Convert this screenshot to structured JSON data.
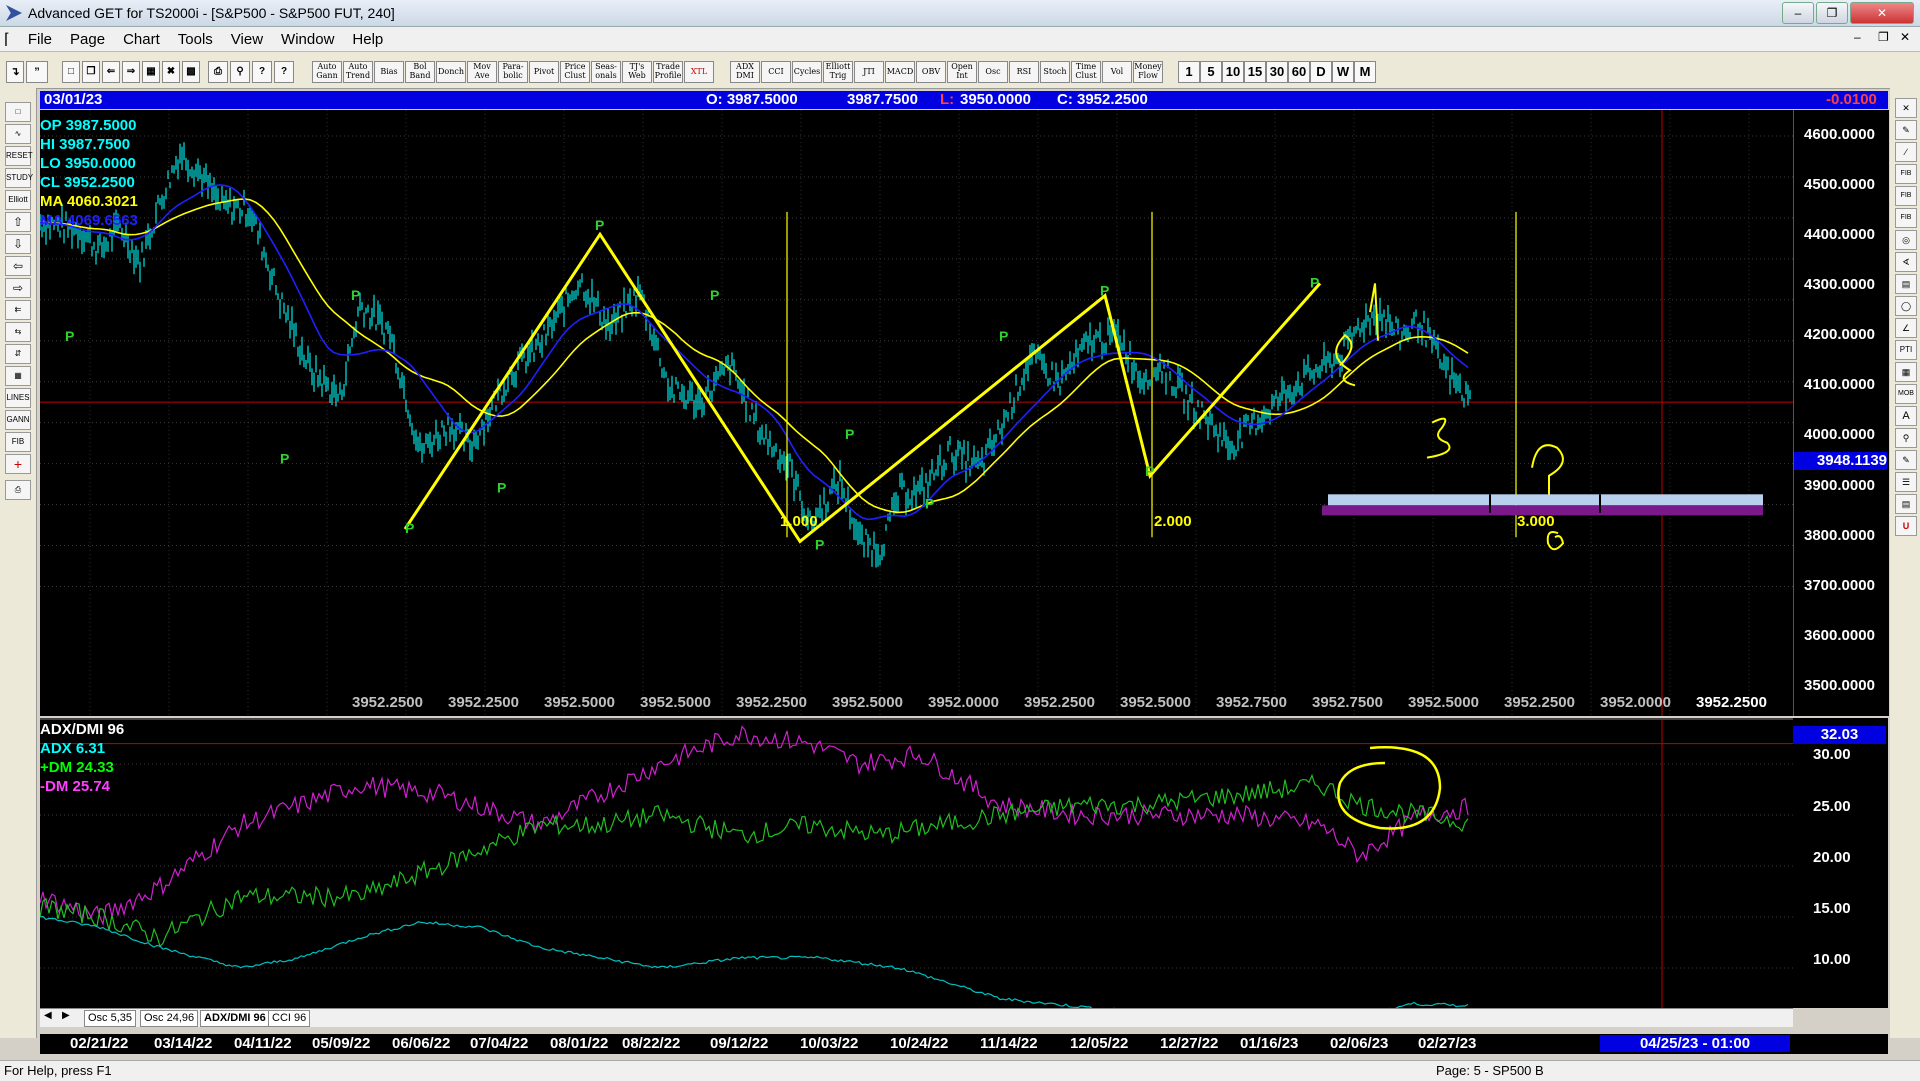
{
  "window": {
    "title": "Advanced GET for TS2000i - [S&P500 - S&P500 FUT, 240]"
  },
  "menu": [
    "File",
    "Page",
    "Chart",
    "Tools",
    "View",
    "Window",
    "Help"
  ],
  "toolbar": {
    "studies": [
      "Auto Gann",
      "Auto Trend",
      "Bias",
      "Bol Band",
      "Donch",
      "Mov Ave",
      "Para-bolic",
      "Pivot",
      "Price Clust",
      "Seas-onals",
      "TJ's Web",
      "Trade Profile",
      "XTL",
      "ADX DMI",
      "CCI",
      "Cycles",
      "Elliott Trig",
      "JTI",
      "MACD",
      "OBV",
      "Open Int",
      "Osc",
      "RSI",
      "Stoch",
      "Time Clust",
      "Vol",
      "Money Flow"
    ],
    "intervals": [
      "1",
      "5",
      "10",
      "15",
      "30",
      "60",
      "D",
      "W",
      "M"
    ]
  },
  "infobar": {
    "date": "03/01/23",
    "open": "O: 3987.5000",
    "high": "3987.7500",
    "low_label": "L:",
    "low": "3950.0000",
    "close": "C: 3952.2500",
    "change": "-0.0100"
  },
  "legend": [
    {
      "text": "OP  3987.5000",
      "color": "#00ffff"
    },
    {
      "text": "HI   3987.7500",
      "color": "#00ffff"
    },
    {
      "text": "LO  3950.0000",
      "color": "#00ffff"
    },
    {
      "text": "CL  3952.2500",
      "color": "#00ffff"
    },
    {
      "text": "MA  4060.3021",
      "color": "#ffff00"
    },
    {
      "text": "MA  4069.6563",
      "color": "#2020ff"
    }
  ],
  "price_axis": [
    "4600.0000",
    "4500.0000",
    "4400.0000",
    "4300.0000",
    "4200.0000",
    "4100.0000",
    "4000.0000",
    "3900.0000",
    "3800.0000",
    "3700.0000",
    "3600.0000",
    "3500.0000"
  ],
  "price_marker": "3948.1139",
  "pivot_bottom_labels": [
    "3952.2500",
    "3952.2500",
    "3952.5000",
    "3952.5000",
    "3952.2500",
    "3952.5000",
    "3952.0000",
    "3952.2500",
    "3952.5000",
    "3952.7500",
    "3952.7500",
    "3952.5000",
    "3952.2500",
    "3952.0000",
    "3952.2500"
  ],
  "fib_labels": [
    "1.000",
    "2.000",
    "3.000"
  ],
  "pivot_marker": "P",
  "osc": {
    "title": "ADX/DMI 96",
    "adx": "ADX 6.31",
    "pdm": "+DM 24.33",
    "mdm": "-DM 25.74",
    "axis": [
      "30.00",
      "25.00",
      "20.00",
      "15.00",
      "10.00"
    ],
    "marker": "32.03"
  },
  "tabs": [
    "Osc 5,35",
    "Osc 24,96",
    "ADX/DMI 96",
    "CCI 96"
  ],
  "dates": [
    "02/21/22",
    "03/14/22",
    "04/11/22",
    "05/09/22",
    "06/06/22",
    "07/04/22",
    "08/01/22",
    "08/22/22",
    "09/12/22",
    "10/03/22",
    "10/24/22",
    "11/14/22",
    "12/05/22",
    "12/27/22",
    "01/16/23",
    "02/06/23",
    "02/27/23"
  ],
  "future_date": "04/25/23 - 01:00",
  "status": {
    "left": "For Help, press F1",
    "right": "Page: 5 - SP500 B"
  },
  "colors": {
    "price": "#00e5e5",
    "ma_yellow": "#ffff00",
    "ma_blue": "#2020ff",
    "annot": "#ffff00",
    "band_light": "#b8d0ee",
    "band_purple": "#7a1a8a"
  }
}
